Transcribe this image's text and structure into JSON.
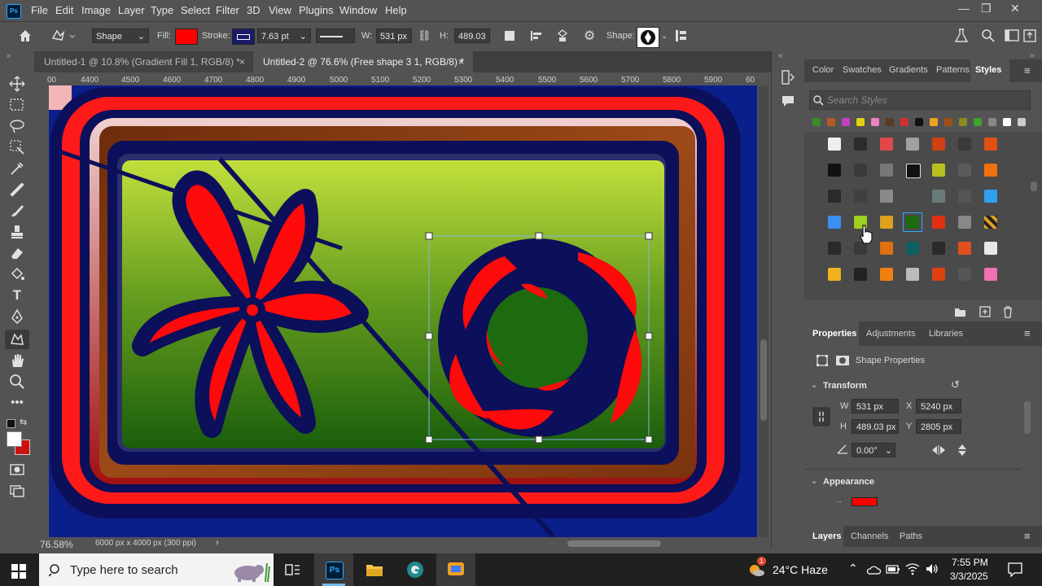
{
  "menu": [
    "File",
    "Edit",
    "Image",
    "Layer",
    "Type",
    "Select",
    "Filter",
    "3D",
    "View",
    "Plugins",
    "Window",
    "Help"
  ],
  "app_logo": "Ps",
  "window_controls": {
    "minimize": "—",
    "restore": "❐",
    "close": "✕"
  },
  "options": {
    "mode": "Shape",
    "fill_label": "Fill:",
    "fill_color": "#ff0000",
    "stroke_label": "Stroke:",
    "stroke_width": "7.63 pt",
    "w_label": "W:",
    "w_value": "531 px",
    "h_label": "H:",
    "h_value": "489.03",
    "shape_label": "Shape:"
  },
  "tabs": [
    {
      "label": "Untitled-1 @ 10.8% (Gradient Fill 1, RGB/8) *",
      "close": "×"
    },
    {
      "label": "Untitled-2 @ 76.6% (Free shape 3 1, RGB/8) *",
      "close": "×"
    }
  ],
  "ruler": [
    "00",
    "4400",
    "4500",
    "4600",
    "4700",
    "4800",
    "4900",
    "5000",
    "5100",
    "5200",
    "5300",
    "5400",
    "5500",
    "5600",
    "5700",
    "5800",
    "5900",
    "60"
  ],
  "status": {
    "zoom": "76.58%",
    "doc_info": "6000 px x 4000 px (300 ppi)"
  },
  "styles_panel": {
    "tabs": [
      "Color",
      "Swatches",
      "Gradients",
      "Patterns",
      "Styles"
    ],
    "search_placeholder": "Search Styles"
  },
  "properties_panel": {
    "tabs": [
      "Properties",
      "Adjustments",
      "Libraries"
    ],
    "shape_properties": "Shape Properties",
    "transform_title": "Transform",
    "w_label": "W",
    "w_value": "531 px",
    "x_label": "X",
    "x_value": "5240 px",
    "h_label": "H",
    "h_value": "489.03 px",
    "y_label": "Y",
    "y_value": "2805 px",
    "angle_value": "0.00°",
    "appearance_title": "Appearance",
    "appearance_color": "#ff0000"
  },
  "layers_panel": {
    "tabs": [
      "Layers",
      "Channels",
      "Paths"
    ]
  },
  "taskbar": {
    "search_placeholder": "Type here to search",
    "ps_label": "Ps",
    "weather": "24°C  Haze",
    "notification_count": "1",
    "time": "7:55 PM",
    "date": "3/3/2025"
  },
  "colors": {
    "accent": "#31a8ff",
    "canvas_bg": "#0b1f8a",
    "frame_red": "#ff1a1a",
    "frame_navy": "#0c0f5a",
    "wood": "#8a3a12",
    "flower_red": "#ff0a0a",
    "gradient_top": "#b9dd3a",
    "gradient_bottom": "#1e6a10"
  }
}
